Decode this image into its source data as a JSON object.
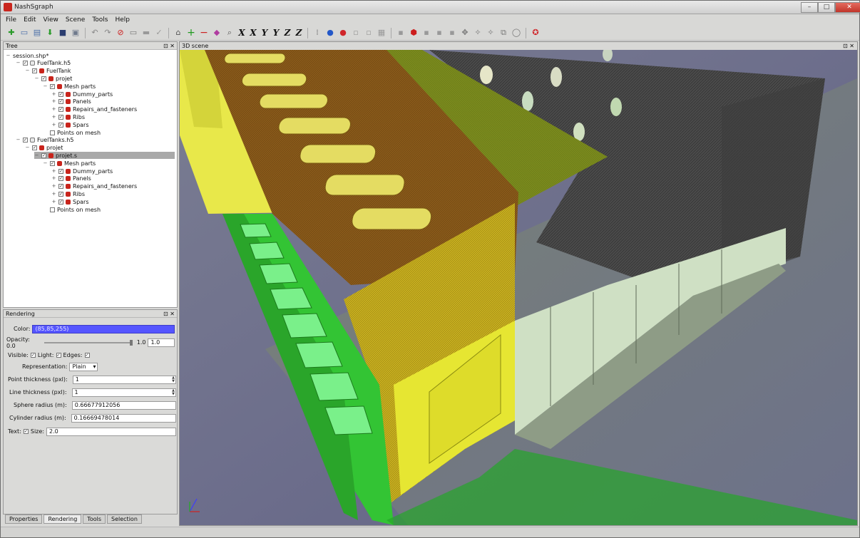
{
  "window": {
    "title": "NashSgraph",
    "min_label": "–",
    "max_label": "□",
    "close_label": "✕"
  },
  "menu": [
    "File",
    "Edit",
    "View",
    "Scene",
    "Tools",
    "Help"
  ],
  "toolbar": {
    "axis_buttons": [
      "X",
      "X",
      "Y",
      "Y",
      "Z",
      "Z"
    ]
  },
  "tree_panel": {
    "title": "Tree",
    "items": [
      {
        "label": "session.shp*"
      },
      {
        "label": "FuelTank.h5"
      },
      {
        "label": "FuelTank"
      },
      {
        "label": "projet"
      },
      {
        "label": "Mesh parts"
      },
      {
        "label": "Dummy_parts"
      },
      {
        "label": "Panels"
      },
      {
        "label": "Repairs_and_fasteners"
      },
      {
        "label": "Ribs"
      },
      {
        "label": "Spars"
      },
      {
        "label": "Points on mesh"
      },
      {
        "label": "FuelTanks.h5"
      },
      {
        "label": "projet"
      },
      {
        "label": "projet.s"
      },
      {
        "label": "Mesh parts"
      },
      {
        "label": "Dummy_parts"
      },
      {
        "label": "Panels"
      },
      {
        "label": "Repairs_and_fasteners"
      },
      {
        "label": "Ribs"
      },
      {
        "label": "Spars"
      },
      {
        "label": "Points on mesh"
      }
    ]
  },
  "rendering_panel": {
    "title": "Rendering",
    "color_label": "Color:",
    "color_value": "(85,85,255)",
    "color_hex": "#5555ff",
    "opacity_label": "Opacity: 0.0",
    "opacity_max": "1.0",
    "opacity_value": "1.0",
    "visible_label": "Visible:",
    "light_label": "Light:",
    "edges_label": "Edges:",
    "representation_label": "Representation:",
    "representation_value": "Plain",
    "point_thickness_label": "Point thickness (pxl):",
    "point_thickness_value": "1",
    "line_thickness_label": "Line thickness (pxl):",
    "line_thickness_value": "1",
    "sphere_radius_label": "Sphere radius (m):",
    "sphere_radius_value": "0.66677912056",
    "cylinder_radius_label": "Cylinder radius (m):",
    "cylinder_radius_value": "0.16669478014",
    "text_label": "Text:",
    "size_label": "Size:",
    "size_value": "2.0"
  },
  "bottom_tabs": [
    "Properties",
    "Rendering",
    "Tools",
    "Selection"
  ],
  "scene_panel": {
    "title": "3D scene"
  }
}
